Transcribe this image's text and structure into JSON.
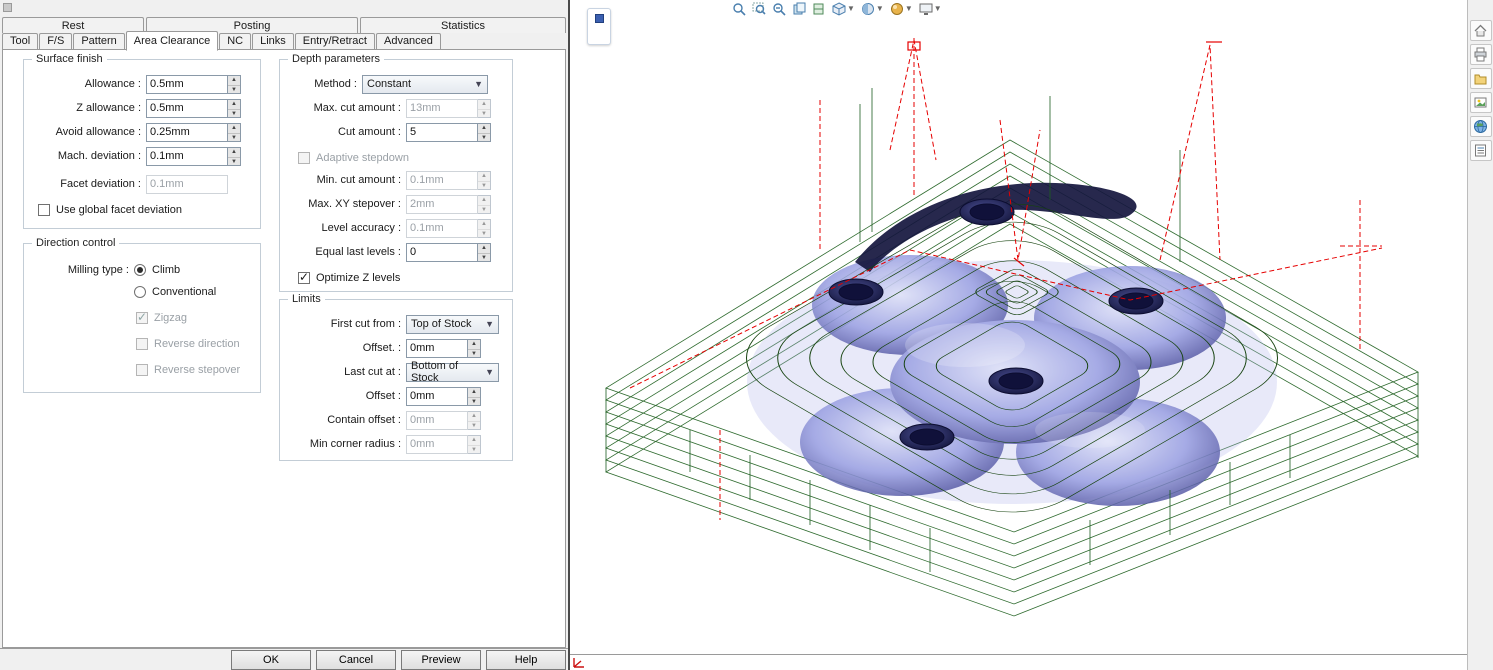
{
  "dialog": {
    "tabs_row1": [
      {
        "label": "Rest"
      },
      {
        "label": "Posting"
      },
      {
        "label": "Statistics"
      }
    ],
    "tabs_row2": [
      {
        "label": "Tool"
      },
      {
        "label": "F/S"
      },
      {
        "label": "Pattern"
      },
      {
        "label": "Area Clearance",
        "active": true
      },
      {
        "label": "NC"
      },
      {
        "label": "Links"
      },
      {
        "label": "Entry/Retract"
      },
      {
        "label": "Advanced"
      }
    ],
    "surface_finish": {
      "title": "Surface finish",
      "allowance": {
        "label": "Allowance :",
        "value": "0.5mm"
      },
      "z_allowance": {
        "label": "Z allowance :",
        "value": "0.5mm"
      },
      "avoid_allowance": {
        "label": "Avoid allowance :",
        "value": "0.25mm"
      },
      "mach_deviation": {
        "label": "Mach. deviation :",
        "value": "0.1mm"
      },
      "facet_deviation": {
        "label": "Facet deviation :",
        "value": "0.1mm",
        "disabled": true
      },
      "use_global_facet": {
        "label": "Use global facet deviation",
        "checked": false
      }
    },
    "direction_control": {
      "title": "Direction control",
      "milling_type_label": "Milling type :",
      "climb": {
        "label": "Climb",
        "selected": true
      },
      "conventional": {
        "label": "Conventional",
        "selected": false
      },
      "zigzag": {
        "label": "Zigzag",
        "checked": true,
        "disabled": true
      },
      "reverse_direction": {
        "label": "Reverse direction",
        "checked": false,
        "disabled": true
      },
      "reverse_stepover": {
        "label": "Reverse stepover",
        "checked": false,
        "disabled": true
      }
    },
    "depth_parameters": {
      "title": "Depth parameters",
      "method": {
        "label": "Method :",
        "value": "Constant"
      },
      "max_cut_amount": {
        "label": "Max. cut amount :",
        "value": "13mm",
        "disabled": true
      },
      "cut_amount": {
        "label": "Cut amount :",
        "value": "5"
      },
      "adaptive_stepdown": {
        "label": "Adaptive stepdown",
        "checked": false,
        "disabled": true
      },
      "min_cut_amount": {
        "label": "Min. cut amount :",
        "value": "0.1mm",
        "disabled": true
      },
      "max_xy_stepover": {
        "label": "Max. XY stepover :",
        "value": "2mm",
        "disabled": true
      },
      "level_accuracy": {
        "label": "Level accuracy :",
        "value": "0.1mm",
        "disabled": true
      },
      "equal_last_levels": {
        "label": "Equal last levels :",
        "value": "0"
      },
      "optimize_z": {
        "label": "Optimize Z levels",
        "checked": true
      }
    },
    "limits": {
      "title": "Limits",
      "first_cut_from": {
        "label": "First cut from :",
        "value": "Top of Stock"
      },
      "offset_top": {
        "label": "Offset. :",
        "value": "0mm"
      },
      "last_cut_at": {
        "label": "Last cut at :",
        "value": "Bottom of Stock"
      },
      "offset_bottom": {
        "label": "Offset :",
        "value": "0mm"
      },
      "contain_offset": {
        "label": "Contain offset :",
        "value": "0mm",
        "disabled": true
      },
      "min_corner_radius": {
        "label": "Min corner radius :",
        "value": "0mm",
        "disabled": true
      }
    },
    "buttons": {
      "ok": "OK",
      "cancel": "Cancel",
      "preview": "Preview",
      "help": "Help"
    }
  },
  "viewport": {
    "toolbar_icons": [
      "zoom-to-fit",
      "zoom-to-area",
      "zoom-in-out",
      "section-view-a",
      "section-view-b",
      "view-orientation",
      "display-style",
      "appearances",
      "view-settings"
    ],
    "side_toolbar_icons": [
      "home",
      "printer",
      "folder",
      "image",
      "web",
      "properties"
    ],
    "colors": {
      "toolpath_green": "#1c5e20",
      "rapid_red": "#e60000",
      "part_purple": "#7e83cf"
    }
  }
}
